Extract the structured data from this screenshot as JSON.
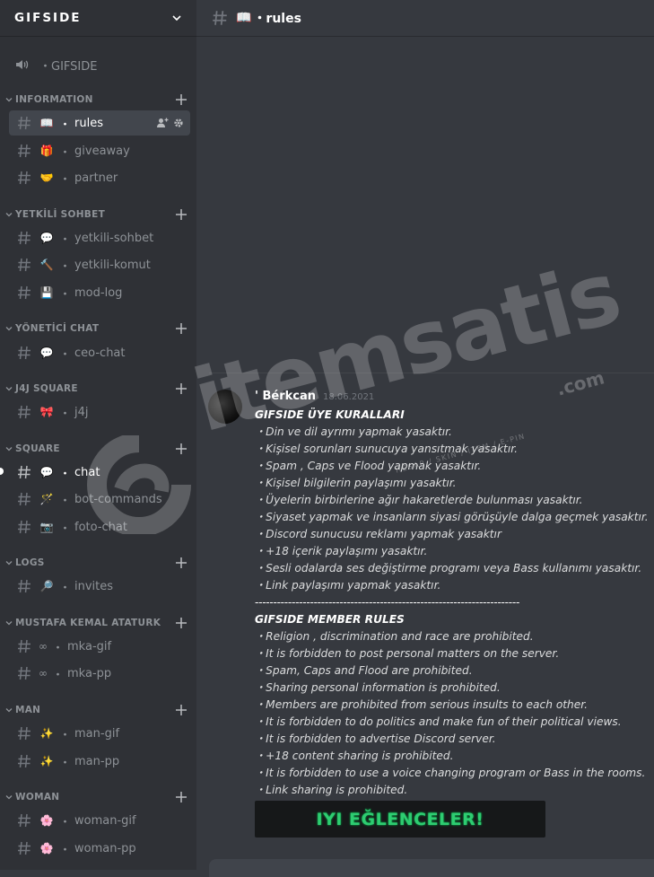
{
  "server": {
    "name": "GIFSIDE"
  },
  "voice_channel": {
    "label": "・GIFSIDE"
  },
  "categories": [
    {
      "name": "INFORMATION"
    },
    {
      "name": "YETKİLİ SOHBET"
    },
    {
      "name": "YÖNETİCİ CHAT"
    },
    {
      "name": "J4J SQUARE"
    },
    {
      "name": "SQUARE"
    },
    {
      "name": "LOGS"
    },
    {
      "name": "MUSTAFA KEMAL ATATURK"
    },
    {
      "name": "MAN"
    },
    {
      "name": "WOMAN"
    }
  ],
  "channels": [
    {
      "emoji": "📖",
      "name": "rules"
    },
    {
      "emoji": "🎁",
      "name": "giveaway"
    },
    {
      "emoji": "🤝",
      "name": "partner"
    },
    {
      "emoji": "💬",
      "name": "yetkili-sohbet"
    },
    {
      "emoji": "🔨",
      "name": "yetkili-komut"
    },
    {
      "emoji": "💾",
      "name": "mod-log"
    },
    {
      "emoji": "💬",
      "name": "ceo-chat"
    },
    {
      "emoji": "🎀",
      "name": "j4j"
    },
    {
      "emoji": "💬",
      "name": "chat"
    },
    {
      "emoji": "🪄",
      "name": "bot-commands"
    },
    {
      "emoji": "📷",
      "name": "foto-chat"
    },
    {
      "emoji": "🔎",
      "name": "invites"
    },
    {
      "emoji": "∞",
      "name": "mka-gif"
    },
    {
      "emoji": "∞",
      "name": "mka-pp"
    },
    {
      "emoji": "✨",
      "name": "man-gif"
    },
    {
      "emoji": "✨",
      "name": "man-pp"
    },
    {
      "emoji": "🌸",
      "name": "woman-gif"
    },
    {
      "emoji": "🌸",
      "name": "woman-pp"
    }
  ],
  "header": {
    "emoji": "📖",
    "channel": "・rules"
  },
  "message": {
    "author": "' Bérkcan",
    "timestamp": "18.06.2021",
    "lines": [
      "GIFSIDE ÜYE KURALLARI",
      "・Din ve dil ayrımı yapmak yasaktır.",
      "・Kişisel sorunları sunucuya yansıtmak yasaktır.",
      "・Spam , Caps ve Flood yapmak yasaktır.",
      "・Kişisel bilgilerin paylaşımı yasaktır.",
      "・Üyelerin birbirlerine ağır hakaretlerde bulunması yasaktır.",
      "・Siyaset yapmak ve insanların siyasi görüşüyle dalga geçmek yasaktır.",
      "・Discord sunucusu reklamı yapmak yasaktır",
      "・+18 içerik paylaşımı yasaktır.",
      "・Sesli odalarda ses değiştirme programı veya Bass kullanımı yasaktır.",
      "・Link paylaşımı yapmak yasaktır.",
      "------------------------------------------------------------------------",
      "GIFSIDE MEMBER RULES",
      "・Religion , discrimination and race are prohibited.",
      "・It is forbidden to post personal matters on the server.",
      "・Spam, Caps and Flood are prohibited.",
      "・Sharing personal information is prohibited.",
      "・Members are prohibited from serious insults to each other.",
      "・It is forbidden to do politics and make fun of their political views.",
      "・It is forbidden to advertise Discord server.",
      "・+18 content sharing is prohibited.",
      "・It is forbidden to use a voice changing program or Bass in the rooms.",
      "・Link sharing is prohibited."
    ],
    "banner": "IYI EĞLENCELER!"
  },
  "watermark": {
    "brand": "itemsatis",
    "domain": ".com",
    "tagline": "HESAP / SKIN / ITEM / E-PIN"
  },
  "colors": {
    "banner_text": "#2ecc71",
    "sidebar": "#2f3136",
    "chat_bg": "#36393f"
  }
}
